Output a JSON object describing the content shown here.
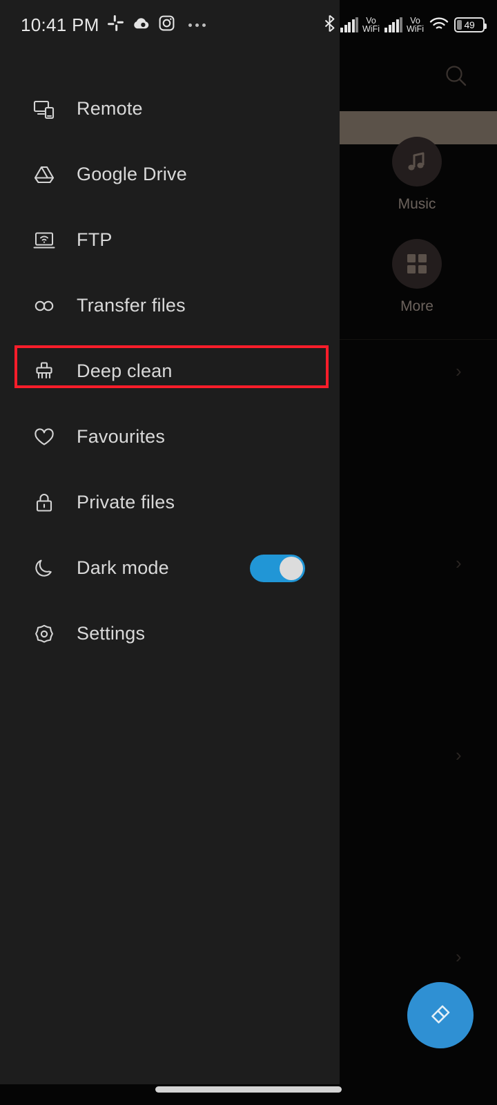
{
  "status_bar": {
    "clock": "10:41 PM",
    "left_icons": [
      "slack-icon",
      "cloud-icon",
      "instagram-icon",
      "overflow-dots-icon"
    ],
    "right_icons": [
      "bluetooth-icon",
      "signal-bars-icon",
      "vowifi-label",
      "signal-bars-icon",
      "vowifi-label",
      "wifi-icon",
      "battery-icon"
    ],
    "vowifi_line1": "Vo",
    "vowifi_line2": "WiFi",
    "battery_level": "49"
  },
  "drawer": {
    "items": [
      {
        "label": "Remote",
        "icon": "remote-cast-icon",
        "name": "remote"
      },
      {
        "label": "Google Drive",
        "icon": "google-drive-icon",
        "name": "google-drive"
      },
      {
        "label": "FTP",
        "icon": "ftp-laptop-wifi-icon",
        "name": "ftp"
      },
      {
        "label": "Transfer files",
        "icon": "infinity-icon",
        "name": "transfer-files"
      },
      {
        "label": "Deep clean",
        "icon": "broom-icon",
        "name": "deep-clean"
      },
      {
        "label": "Favourites",
        "icon": "heart-icon",
        "name": "favourites"
      },
      {
        "label": "Private files",
        "icon": "lock-icon",
        "name": "private-files"
      },
      {
        "label": "Dark mode",
        "icon": "moon-icon",
        "name": "dark-mode",
        "toggle": true,
        "toggle_on": true
      },
      {
        "label": "Settings",
        "icon": "gear-icon",
        "name": "settings"
      }
    ],
    "highlighted_item": "Deep clean"
  },
  "background_app": {
    "search_icon": "search-icon",
    "shortcuts": [
      {
        "label": "Music",
        "icon": "music-note-icon"
      },
      {
        "label": "More",
        "icon": "grid-four-squares-icon"
      }
    ],
    "list_chevrons": [
      "chevron-right-icon",
      "chevron-right-icon",
      "chevron-right-icon"
    ]
  },
  "fab": {
    "icon": "brush-icon",
    "color": "#2f90d3",
    "label": ""
  },
  "colors": {
    "drawer_bg": "#1d1d1d",
    "app_bg": "#050505",
    "accent_blue": "#2196d6",
    "highlight_red": "#fa1d2a",
    "grey_bar": "#5b5249",
    "label_text": "#d9d9d9"
  },
  "gesture_bar": {
    "present": true
  }
}
